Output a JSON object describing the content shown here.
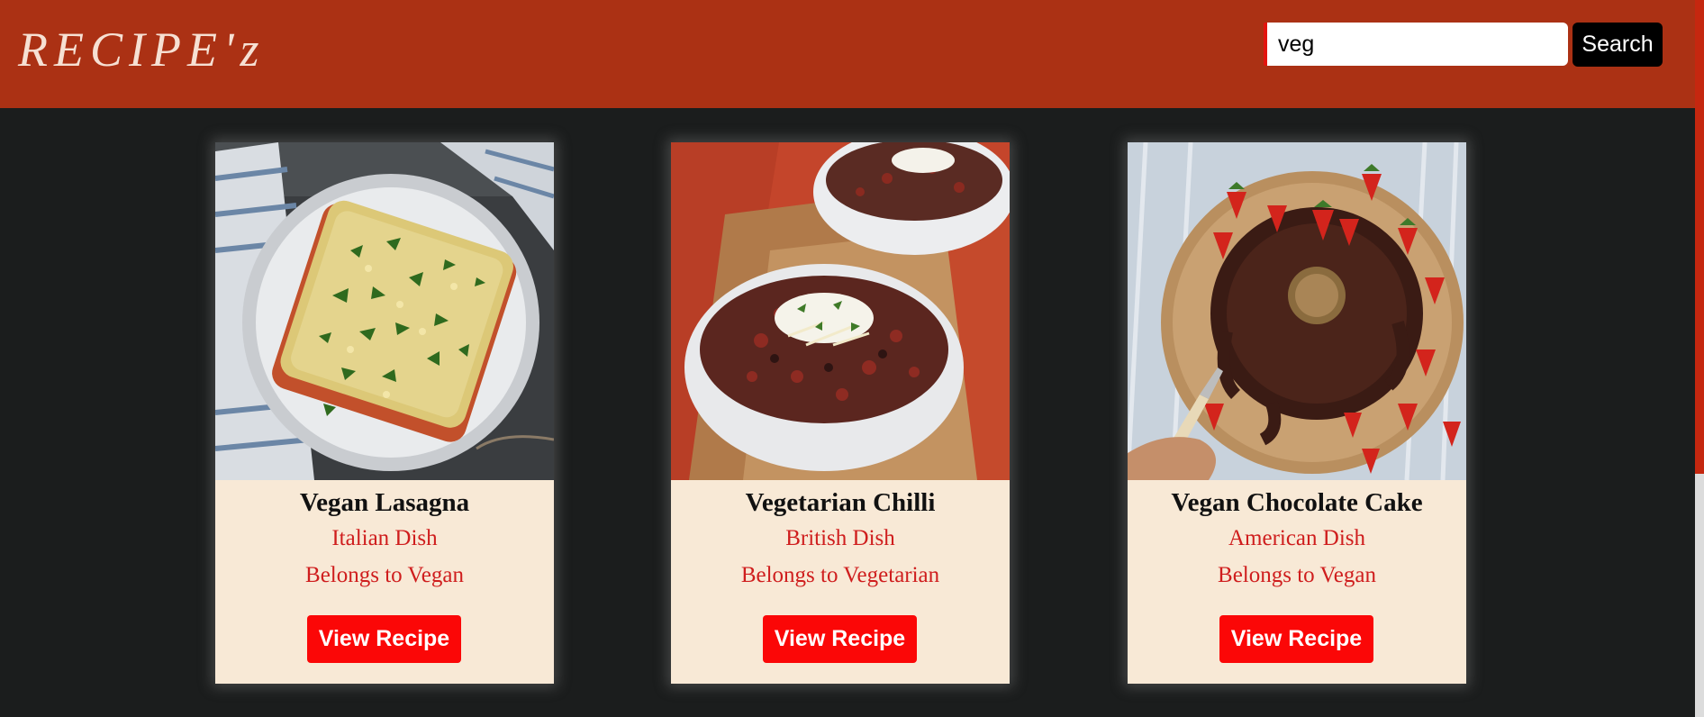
{
  "header": {
    "logo": "RECIPE'z",
    "search": {
      "value": "veg",
      "button_label": "Search"
    }
  },
  "recipes": [
    {
      "title": "Vegan Lasagna",
      "cuisine": "Italian Dish",
      "category": "Belongs to Vegan",
      "button_label": "View Recipe"
    },
    {
      "title": "Vegetarian Chilli",
      "cuisine": "British Dish",
      "category": "Belongs to Vegetarian",
      "button_label": "View Recipe"
    },
    {
      "title": "Vegan Chocolate Cake",
      "cuisine": "American Dish",
      "category": "Belongs to Vegan",
      "button_label": "View Recipe"
    }
  ],
  "colors": {
    "header_bg": "#ab3114",
    "page_bg": "#1b1d1d",
    "card_bg": "#f8e9d6",
    "accent_red": "#fb0707",
    "subtitle_red": "#cf1d1d"
  }
}
